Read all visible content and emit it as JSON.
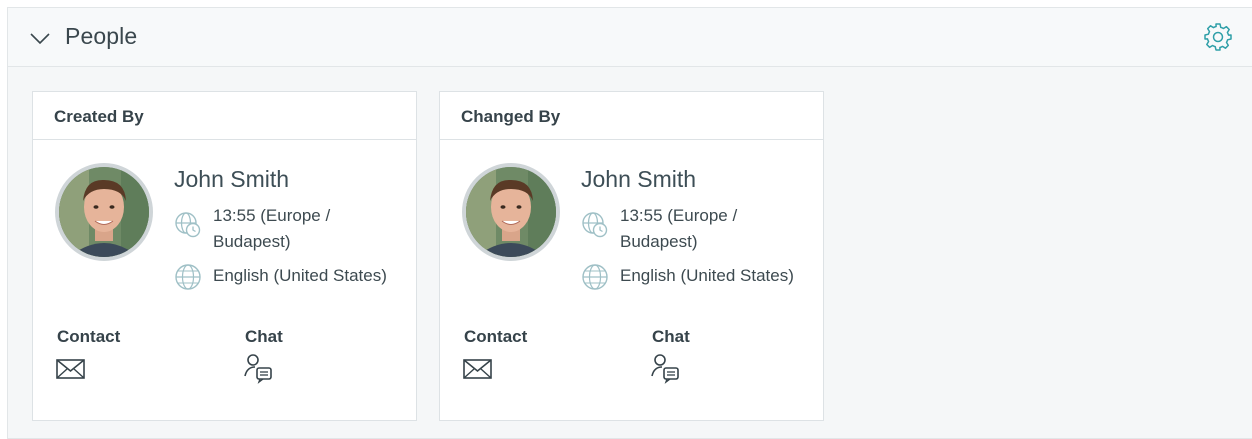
{
  "widget": {
    "title": "People",
    "collapse_icon": "chevron-down-icon",
    "settings_icon": "gear-icon"
  },
  "cards": [
    {
      "header": "Created By",
      "name": "John Smith",
      "timezone": "13:55 (Europe / Budapest)",
      "language": "English (United States)",
      "contact_label": "Contact",
      "chat_label": "Chat"
    },
    {
      "header": "Changed By",
      "name": "John Smith",
      "timezone": "13:55 (Europe / Budapest)",
      "language": "English (United States)",
      "contact_label": "Contact",
      "chat_label": "Chat"
    }
  ],
  "colors": {
    "accent": "#2f9fa8",
    "icon_muted": "#9fc0c6",
    "text": "#2e3a40"
  }
}
